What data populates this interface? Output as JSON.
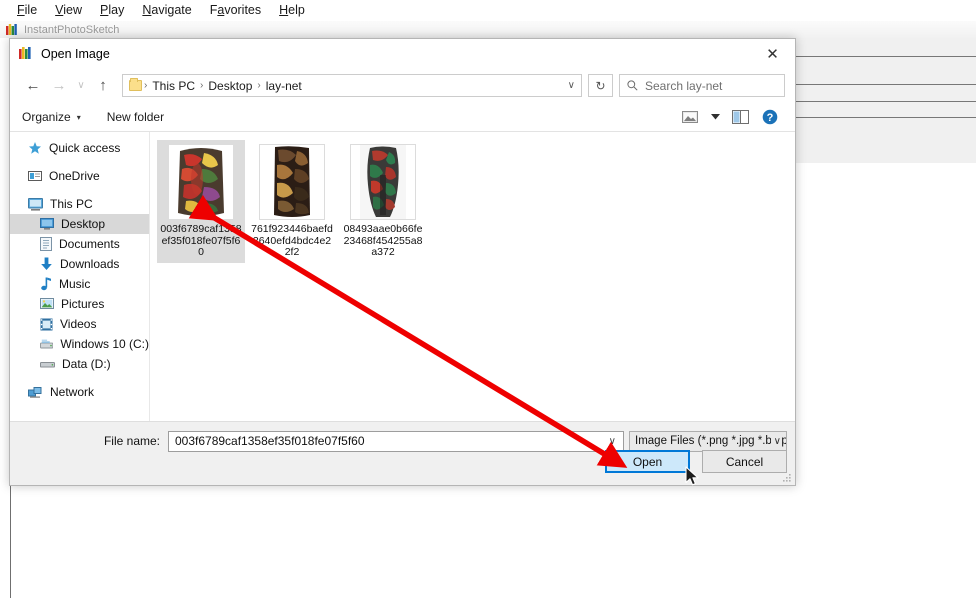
{
  "app": {
    "title": "InstantPhotoSketch",
    "menu": [
      {
        "label": "File",
        "accel": "F"
      },
      {
        "label": "View",
        "accel": "V"
      },
      {
        "label": "Play",
        "accel": "P"
      },
      {
        "label": "Navigate",
        "accel": "N"
      },
      {
        "label": "Favorites",
        "accel": "a"
      },
      {
        "label": "Help",
        "accel": "H"
      }
    ]
  },
  "dialog": {
    "title": "Open Image",
    "icon": "app-icon",
    "close_label": "✕",
    "nav": {
      "back": "←",
      "forward": "→",
      "history": "∨",
      "up": "↑",
      "breadcrumb": [
        "This PC",
        "Desktop",
        "lay-net"
      ],
      "breadcrumb_sep": "›",
      "dropdown": "∨",
      "refresh": "↻"
    },
    "search": {
      "placeholder": "Search lay-net",
      "icon": "search-icon"
    },
    "commands": {
      "organize": "Organize",
      "organize_caret": "▾",
      "new_folder": "New folder",
      "view_icon": "view-options-icon",
      "view_caret": "▾",
      "pane_icon": "preview-pane-icon",
      "help_icon": "help-icon"
    },
    "sidebar": [
      {
        "label": "Quick access",
        "icon": "star-icon",
        "indent": false,
        "selected": false
      },
      {
        "label": "OneDrive",
        "icon": "onedrive-icon",
        "indent": false,
        "selected": false
      },
      {
        "label": "This PC",
        "icon": "computer-icon",
        "indent": false,
        "selected": false
      },
      {
        "label": "Desktop",
        "icon": "desktop-icon",
        "indent": true,
        "selected": true
      },
      {
        "label": "Documents",
        "icon": "documents-icon",
        "indent": true,
        "selected": false
      },
      {
        "label": "Downloads",
        "icon": "downloads-icon",
        "indent": true,
        "selected": false
      },
      {
        "label": "Music",
        "icon": "music-icon",
        "indent": true,
        "selected": false
      },
      {
        "label": "Pictures",
        "icon": "pictures-icon",
        "indent": true,
        "selected": false
      },
      {
        "label": "Videos",
        "icon": "videos-icon",
        "indent": true,
        "selected": false
      },
      {
        "label": "Windows 10 (C:)",
        "icon": "drive-icon",
        "indent": true,
        "selected": false
      },
      {
        "label": "Data (D:)",
        "icon": "drive-icon",
        "indent": true,
        "selected": false
      },
      {
        "label": "Network",
        "icon": "network-icon",
        "indent": false,
        "selected": false
      }
    ],
    "files": [
      {
        "name": "003f6789caf1358ef35f018fe07f5f60",
        "selected": true
      },
      {
        "name": "761f923446baefd3640efd4bdc4e22f2",
        "selected": false
      },
      {
        "name": "08493aae0b66fe23468f454255a8a372",
        "selected": false
      }
    ],
    "filename_label": "File name:",
    "filename_value": "003f6789caf1358ef35f018fe07f5f60",
    "filter_value": "Image Files (*.png *.jpg *.bmp ",
    "open_button": "Open",
    "cancel_button": "Cancel"
  },
  "colors": {
    "accent": "#0078d7",
    "annotation": "#ee0000",
    "selection": "#dcdcdc",
    "sidebar_selection": "#d8d8d8"
  }
}
